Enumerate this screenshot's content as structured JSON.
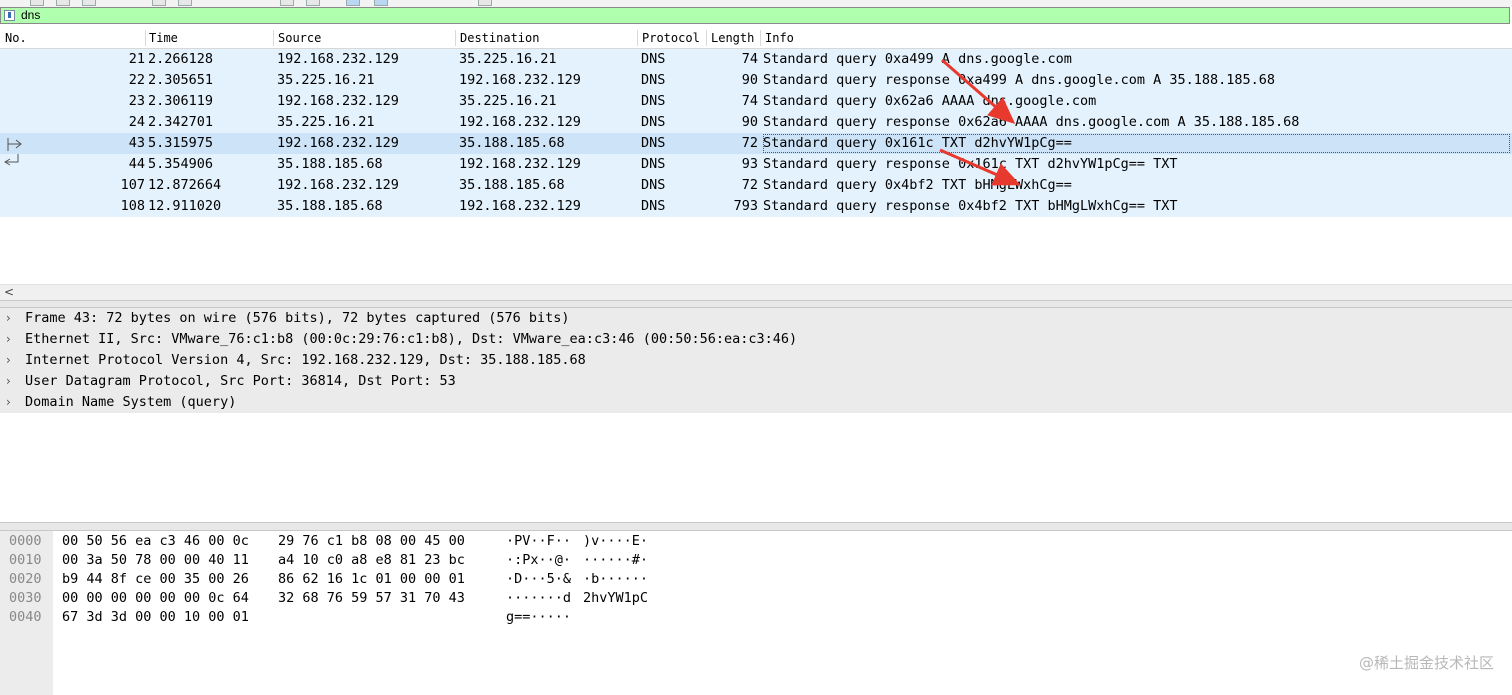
{
  "filter": {
    "value": "dns"
  },
  "columns": {
    "no": "No.",
    "time": "Time",
    "source": "Source",
    "destination": "Destination",
    "protocol": "Protocol",
    "length": "Length",
    "info": "Info"
  },
  "packets": [
    {
      "no": "21",
      "time": "2.266128",
      "src": "192.168.232.129",
      "dst": "35.225.16.21",
      "proto": "DNS",
      "len": "74",
      "info": "Standard query 0xa499 A dns.google.com"
    },
    {
      "no": "22",
      "time": "2.305651",
      "src": "35.225.16.21",
      "dst": "192.168.232.129",
      "proto": "DNS",
      "len": "90",
      "info": "Standard query response 0xa499 A dns.google.com A 35.188.185.68"
    },
    {
      "no": "23",
      "time": "2.306119",
      "src": "192.168.232.129",
      "dst": "35.225.16.21",
      "proto": "DNS",
      "len": "74",
      "info": "Standard query 0x62a6 AAAA dns.google.com"
    },
    {
      "no": "24",
      "time": "2.342701",
      "src": "35.225.16.21",
      "dst": "192.168.232.129",
      "proto": "DNS",
      "len": "90",
      "info": "Standard query response 0x62a6 AAAA dns.google.com A 35.188.185.68"
    },
    {
      "no": "43",
      "time": "5.315975",
      "src": "192.168.232.129",
      "dst": "35.188.185.68",
      "proto": "DNS",
      "len": "72",
      "info": "Standard query 0x161c TXT d2hvYW1pCg=="
    },
    {
      "no": "44",
      "time": "5.354906",
      "src": "35.188.185.68",
      "dst": "192.168.232.129",
      "proto": "DNS",
      "len": "93",
      "info": "Standard query response 0x161c TXT d2hvYW1pCg== TXT"
    },
    {
      "no": "107",
      "time": "12.872664",
      "src": "192.168.232.129",
      "dst": "35.188.185.68",
      "proto": "DNS",
      "len": "72",
      "info": "Standard query 0x4bf2 TXT bHMgLWxhCg=="
    },
    {
      "no": "108",
      "time": "12.911020",
      "src": "35.188.185.68",
      "dst": "192.168.232.129",
      "proto": "DNS",
      "len": "793",
      "info": "Standard query response 0x4bf2 TXT bHMgLWxhCg== TXT"
    }
  ],
  "selected_packet": "43",
  "details": [
    "Frame 43: 72 bytes on wire (576 bits), 72 bytes captured (576 bits)",
    "Ethernet II, Src: VMware_76:c1:b8 (00:0c:29:76:c1:b8), Dst: VMware_ea:c3:46 (00:50:56:ea:c3:46)",
    "Internet Protocol Version 4, Src: 192.168.232.129, Dst: 35.188.185.68",
    "User Datagram Protocol, Src Port: 36814, Dst Port: 53",
    "Domain Name System (query)"
  ],
  "bytes": [
    {
      "off": "0000",
      "hex1": "00 50 56 ea c3 46 00 0c",
      "hex2": "29 76 c1 b8 08 00 45 00",
      "asc1": "·PV··F··",
      "asc2": ")v····E·"
    },
    {
      "off": "0010",
      "hex1": "00 3a 50 78 00 00 40 11",
      "hex2": "a4 10 c0 a8 e8 81 23 bc",
      "asc1": "·:Px··@·",
      "asc2": "······#·"
    },
    {
      "off": "0020",
      "hex1": "b9 44 8f ce 00 35 00 26",
      "hex2": "86 62 16 1c 01 00 00 01",
      "asc1": "·D···5·&",
      "asc2": "·b······"
    },
    {
      "off": "0030",
      "hex1": "00 00 00 00 00 00 0c 64",
      "hex2": "32 68 76 59 57 31 70 43",
      "asc1": "·······d",
      "asc2": "2hvYW1pC"
    },
    {
      "off": "0040",
      "hex1": "67 3d 3d 00 00 10 00 01",
      "hex2": "",
      "asc1": "g==·····",
      "asc2": ""
    }
  ],
  "watermark": "@稀土掘金技术社区",
  "colors": {
    "filter_ok": "#afffaf",
    "row_bg": "#e4f2fd",
    "row_selected": "#cde3f7",
    "annotation_arrow": "#e8392e"
  }
}
